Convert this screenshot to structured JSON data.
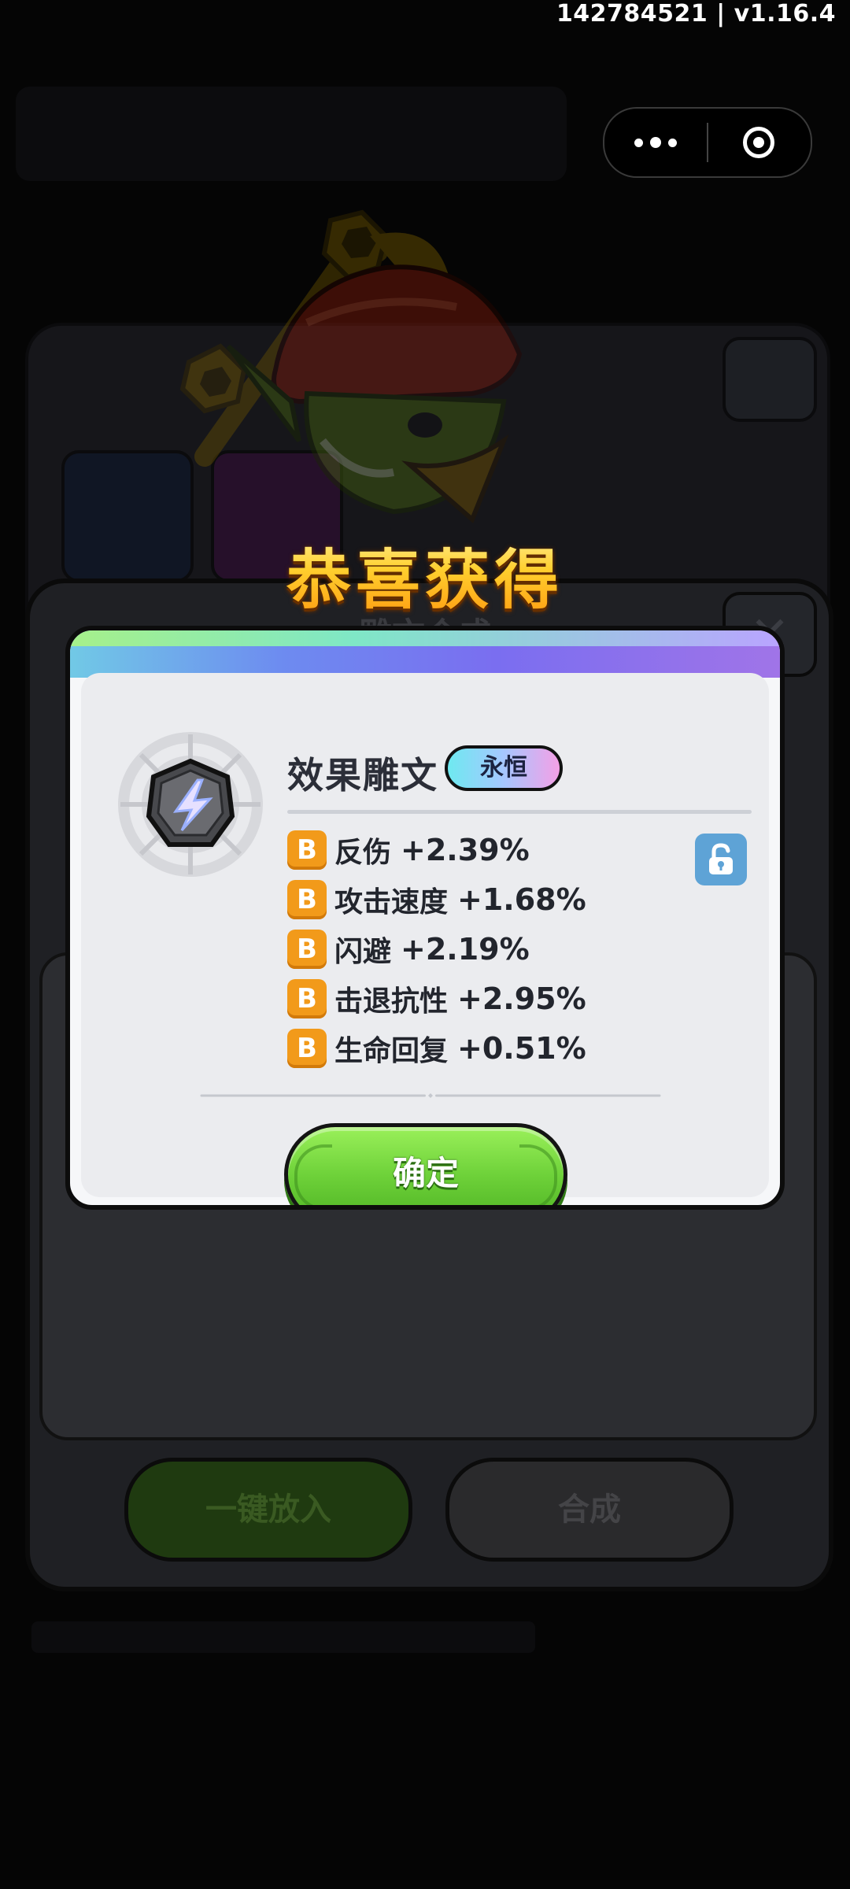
{
  "status": {
    "build": "142784521 | v1.16.4"
  },
  "reward": {
    "title": "恭喜获得"
  },
  "item": {
    "name": "效果雕文",
    "rarity": "永恒",
    "icon": "rune-glyph-lightning",
    "locked": false,
    "stats": [
      {
        "grade": "B",
        "name": "反伤",
        "value": "+2.39%"
      },
      {
        "grade": "B",
        "name": "攻击速度",
        "value": "+1.68%"
      },
      {
        "grade": "B",
        "name": "闪避",
        "value": "+2.19%"
      },
      {
        "grade": "B",
        "name": "击退抗性",
        "value": "+2.95%"
      },
      {
        "grade": "B",
        "name": "生命回复",
        "value": "+0.51%"
      }
    ]
  },
  "modal": {
    "confirm_label": "确定"
  },
  "background": {
    "panel_title": "雕文合成",
    "auto_fill_label": "一键放入",
    "synthesize_label": "合成"
  },
  "colors": {
    "title_gold": "#ffcf2e",
    "grade_orange": "#f29a1a",
    "confirm_green": "#6fd23a",
    "lock_blue": "#5ea3d6"
  }
}
